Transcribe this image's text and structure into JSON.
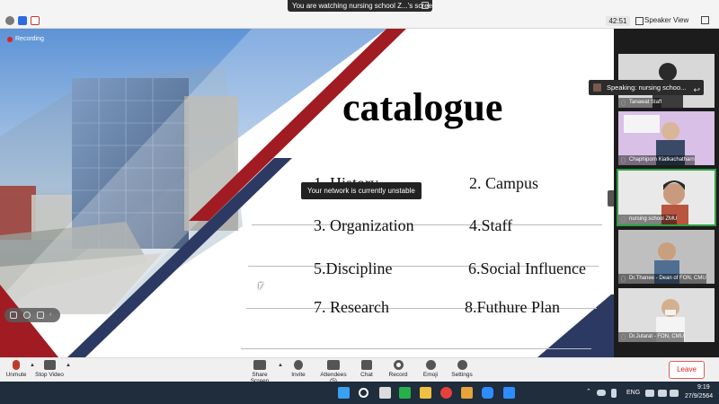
{
  "window": {
    "share_banner": "You are watching nursing school Z...'s screen",
    "timer": "42:51",
    "view_label": "Speaker View"
  },
  "slide": {
    "recording_label": "Recording",
    "title": "catalogue",
    "items": [
      "1. History",
      "2. Campus",
      "3. Organization",
      "4.Staff",
      "5.Discipline",
      "6.Social Influence",
      "7. Research",
      "8.Futhure Plan"
    ],
    "tooltip": "Your network is currently unstable",
    "colors": {
      "red": "#a01c22",
      "navy": "#2c3a63"
    }
  },
  "participants": {
    "speaking_banner": "Speaking: nursing schoo...",
    "tiles": [
      {
        "name": "Tanawat Staff"
      },
      {
        "name": "Chaphiporn Kiatkachatharn"
      },
      {
        "name": "nursing school ZMU"
      },
      {
        "name": "Dr.Thanee - Dean of FON, CMU"
      },
      {
        "name": "Dr.Jutarat - FON, CMU"
      }
    ]
  },
  "toolbar": {
    "unmute": "Unmute",
    "stop_video": "Stop Video",
    "share_screen": "Share Screen",
    "invite": "Invite",
    "attendees": "Attendees (5)",
    "chat": "Chat",
    "record": "Record",
    "emoji": "Emoji",
    "settings": "Settings",
    "leave": "Leave"
  },
  "taskbar": {
    "language": "ENG",
    "time": "9:19",
    "date": "27/9/2564"
  }
}
